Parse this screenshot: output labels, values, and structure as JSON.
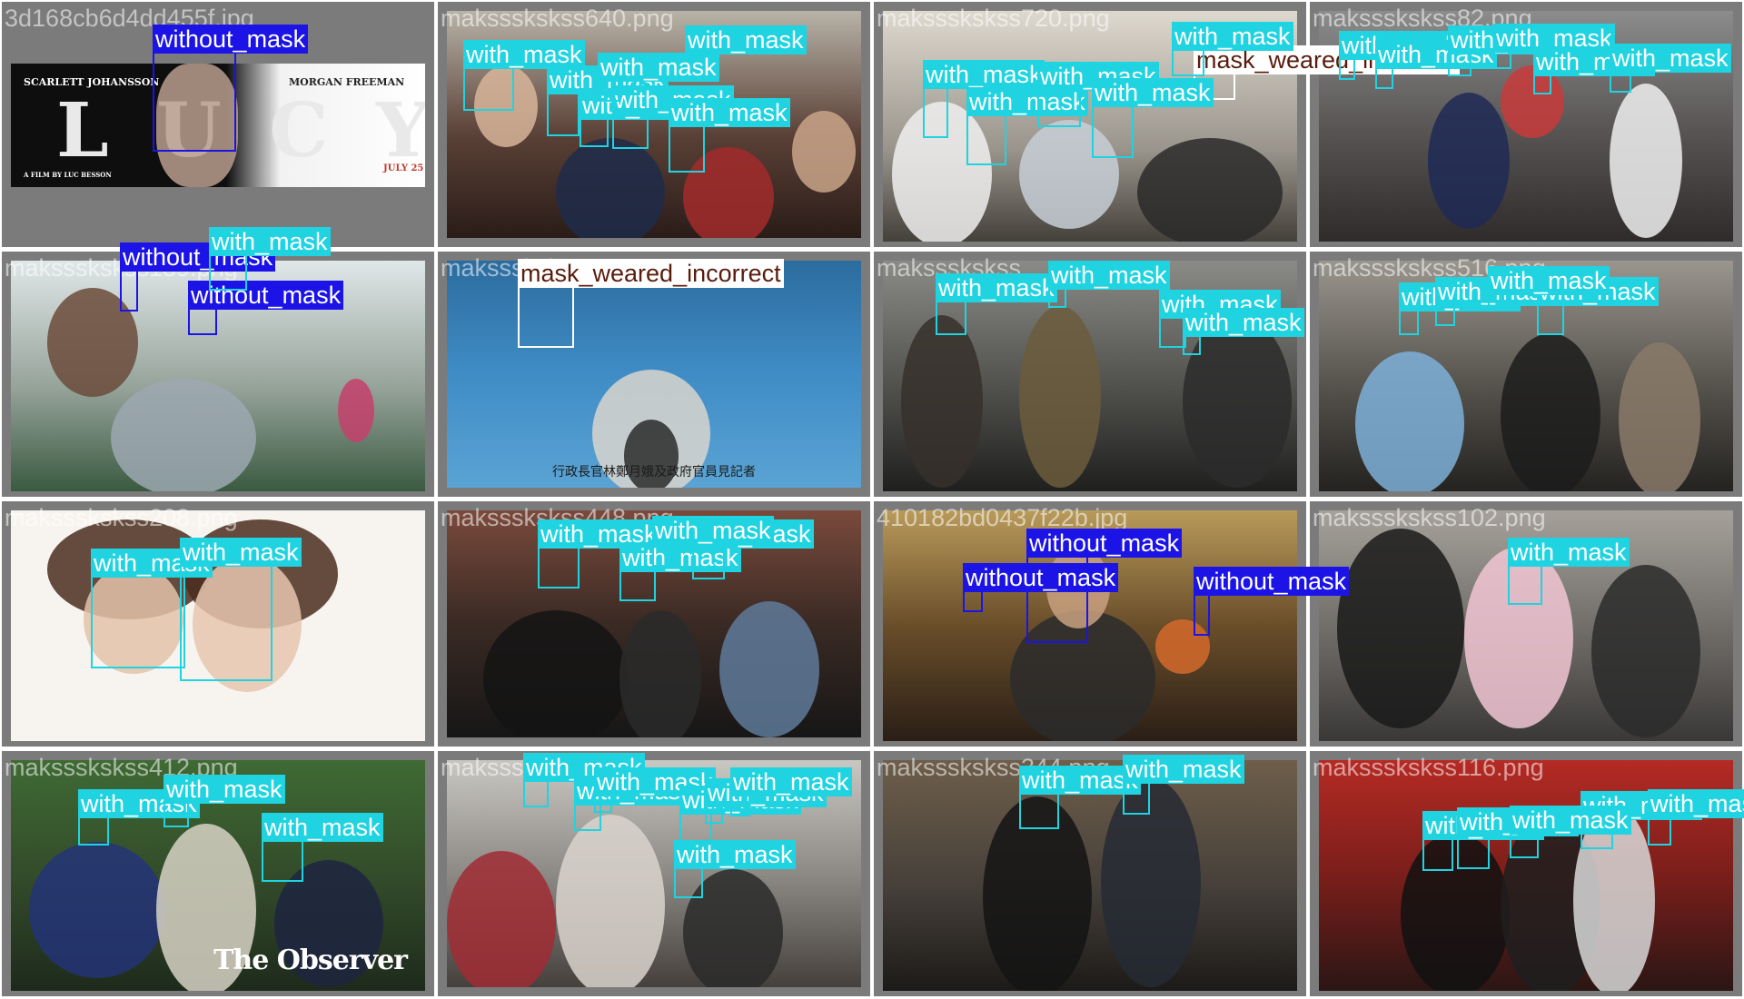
{
  "classes": {
    "with_mask": {
      "label": "with_mask",
      "color": "#1fd3e0"
    },
    "without_mask": {
      "label": "without_mask",
      "color": "#1c14e6"
    },
    "mask_weared_incorrect": {
      "label": "mask_weared_incorrect",
      "color": "#ffffff"
    }
  },
  "cells": [
    {
      "filename": "3d168cb6d4dd455f.jpg",
      "scene": "poster",
      "poster": {
        "left_name": "SCARLETT JOHANSSON",
        "right_name": "MORGAN FREEMAN",
        "title_letters": "L U C Y",
        "date": "JULY 25",
        "credit": "A FILM BY LUC BESSON"
      }
    },
    {
      "filename": "makssskskss640.png",
      "scene": "crowd-warm"
    },
    {
      "filename": "makssskskss720.png",
      "scene": "clinic"
    },
    {
      "filename": "makssskskss82.png",
      "scene": "station"
    },
    {
      "filename": "makssskskss189.png",
      "scene": "airport"
    },
    {
      "filename": "makssskskss406.png",
      "scene": "tv-water",
      "caption": "行政長官林鄭月娥及政府官員見記者"
    },
    {
      "filename": "makssskskss...",
      "scene": "subway"
    },
    {
      "filename": "makssskskss516.png",
      "scene": "crowd-blue"
    },
    {
      "filename": "makssskskss208.png",
      "scene": "white-portrait"
    },
    {
      "filename": "makssskskss448.png",
      "scene": "street-dark"
    },
    {
      "filename": "410182bd0437f22b.jpg",
      "scene": "restaurant"
    },
    {
      "filename": "makssskskss102.png",
      "scene": "stroller"
    },
    {
      "filename": "makssskskss412.png",
      "scene": "park",
      "watermark": "The Observer"
    },
    {
      "filename": "makssskskss...",
      "scene": "crowd-bright"
    },
    {
      "filename": "makssskskss344.png",
      "scene": "platform"
    },
    {
      "filename": "makssskskss116.png",
      "scene": "red-station"
    }
  ]
}
